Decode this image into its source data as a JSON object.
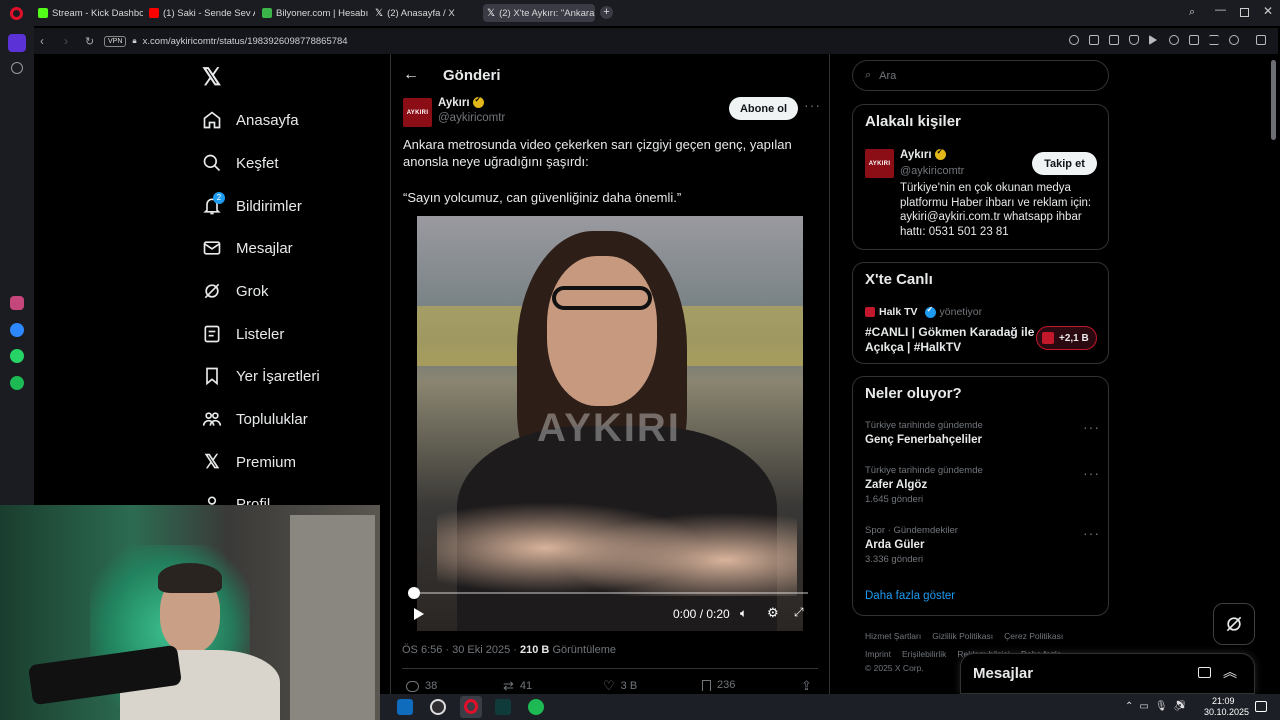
{
  "browser": {
    "tabs": [
      {
        "label": "Stream - Kick Dashboard",
        "color": "#53fc18"
      },
      {
        "label": "(1) Saki - Sende Sev Ama",
        "color": "#ff0000"
      },
      {
        "label": "Bilyoner.com | Hesabım | ",
        "color": "#3bb54a"
      },
      {
        "label": "(2) Anasayfa / X",
        "color": "#ffffff"
      },
      {
        "label": "(2) X'te Aykırı: \"Ankara me",
        "color": "#ffffff"
      }
    ],
    "url": "x.com/aykiricomtr/status/1983926098778865784",
    "vpn": "VPN"
  },
  "nav": {
    "items": [
      {
        "label": "Anasayfa",
        "icon": "home-icon"
      },
      {
        "label": "Keşfet",
        "icon": "search-icon"
      },
      {
        "label": "Bildirimler",
        "icon": "bell-icon",
        "badge": "2"
      },
      {
        "label": "Mesajlar",
        "icon": "mail-icon"
      },
      {
        "label": "Grok",
        "icon": "grok-icon"
      },
      {
        "label": "Listeler",
        "icon": "list-icon"
      },
      {
        "label": "Yer İşaretleri",
        "icon": "bookmark-icon"
      },
      {
        "label": "Topluluklar",
        "icon": "communities-icon"
      },
      {
        "label": "Premium",
        "icon": "x-logo-icon"
      },
      {
        "label": "Profil",
        "icon": "profile-icon"
      }
    ]
  },
  "post": {
    "header": "Gönderi",
    "author_name": "Aykırı",
    "author_handle": "@aykiricomtr",
    "subscribe_label": "Abone ol",
    "text_line1": "Ankara metrosunda video çekerken sarı çizgiyi geçen genç, yapılan",
    "text_line2": "anonsla neye uğradığını şaşırdı:",
    "quote": "“Sayın yolcumuz, can güvenliğiniz daha önemli.”",
    "watermark": "AYKIRI",
    "video_time": "0:00 / 0:20",
    "timestamp": "ÖS 6:56 · 30 Eki 2025 ·",
    "views": "210 B",
    "views_label": "Görüntüleme",
    "replies": "38",
    "reposts": "41",
    "likes": "3 B",
    "bookmarks": "236",
    "logo_text": "AYKIRI"
  },
  "right": {
    "search_placeholder": "Ara",
    "related_title": "Alakalı kişiler",
    "related_name": "Aykırı",
    "related_handle": "@aykiricomtr",
    "follow_label": "Takip et",
    "related_bio1": "Türkiye'nin en çok okunan medya",
    "related_bio2": "platformu Haber ihbarı ve reklam için:",
    "related_bio3": "aykiri@aykiri.com.tr whatsapp ihbar",
    "related_bio4": "hattı: 0531 501 23 81",
    "live_title": "X'te Canlı",
    "live_source": "Halk TV",
    "live_role": "yönetiyor",
    "live_text1": "#CANLI | Gökmen Karadağ ile",
    "live_text2": "Açıkça | #HalkTV",
    "live_count": "+2,1 B",
    "trends_title": "Neler oluyor?",
    "trends": [
      {
        "context": "Türkiye tarihinde gündemde",
        "name": "Genç Fenerbahçeliler",
        "count": ""
      },
      {
        "context": "Türkiye tarihinde gündemde",
        "name": "Zafer Algöz",
        "count": "1.645 gönderi"
      },
      {
        "context": "Spor · Gündemdekiler",
        "name": "Arda Güler",
        "count": "3.336 gönderi"
      }
    ],
    "show_more": "Daha fazla göster",
    "footer1": [
      "Hizmet Şartları",
      "Gizlilik Politikası",
      "Çerez Politikası"
    ],
    "footer2": [
      "Imprint",
      "Erişilebilirlik",
      "Reklam bilgisi",
      "Daha fazla"
    ],
    "copyright": "© 2025 X Corp.",
    "messages_label": "Mesajlar"
  },
  "taskbar": {
    "time": "21:09",
    "date": "30.10.2025"
  }
}
